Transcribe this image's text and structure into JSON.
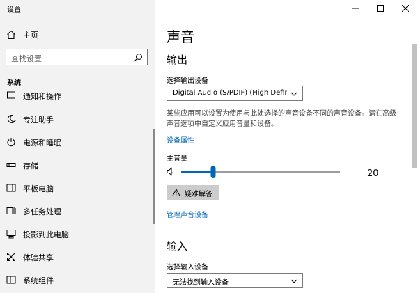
{
  "window": {
    "title": "设置"
  },
  "nav": {
    "home_label": "主页",
    "search_placeholder": "查找设置",
    "section": "系统",
    "items": [
      {
        "label": "通知和操作",
        "icon": "notification-icon"
      },
      {
        "label": "专注助手",
        "icon": "moon-icon"
      },
      {
        "label": "电源和睡眠",
        "icon": "power-icon"
      },
      {
        "label": "存储",
        "icon": "storage-icon"
      },
      {
        "label": "平板电脑",
        "icon": "tablet-icon"
      },
      {
        "label": "多任务处理",
        "icon": "multitask-icon"
      },
      {
        "label": "投影到此电脑",
        "icon": "project-icon"
      },
      {
        "label": "体验共享",
        "icon": "shared-experience-icon"
      },
      {
        "label": "系统组件",
        "icon": "components-icon"
      }
    ]
  },
  "main": {
    "title": "声音",
    "output": {
      "heading": "输出",
      "select_label": "选择输出设备",
      "device": "Digital Audio (S/PDIF) (High Definiti...",
      "description": "某些应用可以设置为使用与此处选择的声音设备不同的声音设备。请在高级声音选项中自定义应用音量和设备。",
      "properties_link": "设备属性",
      "volume_label": "主音量",
      "volume_value": "20",
      "volume_fraction": 0.2,
      "troubleshoot": "疑难解答",
      "manage_link": "管理声音设备"
    },
    "input": {
      "heading": "输入",
      "select_label": "选择输入设备",
      "device": "无法找到输入设备"
    }
  },
  "colors": {
    "accent": "#0067b8",
    "nav_bg": "#f2f2f2",
    "button_bg": "#cccccc"
  }
}
